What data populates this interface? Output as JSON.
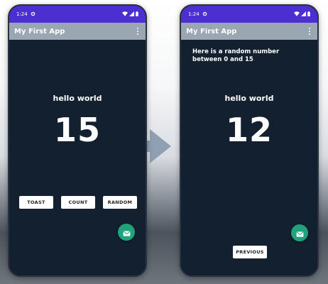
{
  "phone1": {
    "status": {
      "time": "1:24"
    },
    "appbar": {
      "title": "My First App"
    },
    "hello": "hello world",
    "number": "15",
    "buttons": {
      "toast": "TOAST",
      "count": "COUNT",
      "random": "RANDOM"
    }
  },
  "phone2": {
    "status": {
      "time": "1:24"
    },
    "appbar": {
      "title": "My First App"
    },
    "random_label": "Here is a random number between 0 and 15",
    "hello": "hello world",
    "number": "12",
    "buttons": {
      "previous": "PREVIOUS"
    }
  },
  "colors": {
    "statusbar": "#4b2fd0",
    "appbar": "#9aa6b2",
    "background": "#13202f",
    "fab": "#1fa37a",
    "arrow": "#8b9bb0"
  },
  "icons": [
    "gear-icon",
    "wifi-icon",
    "signal-icon",
    "battery-icon",
    "overflow-menu-icon",
    "mail-icon",
    "transition-arrow-icon"
  ]
}
